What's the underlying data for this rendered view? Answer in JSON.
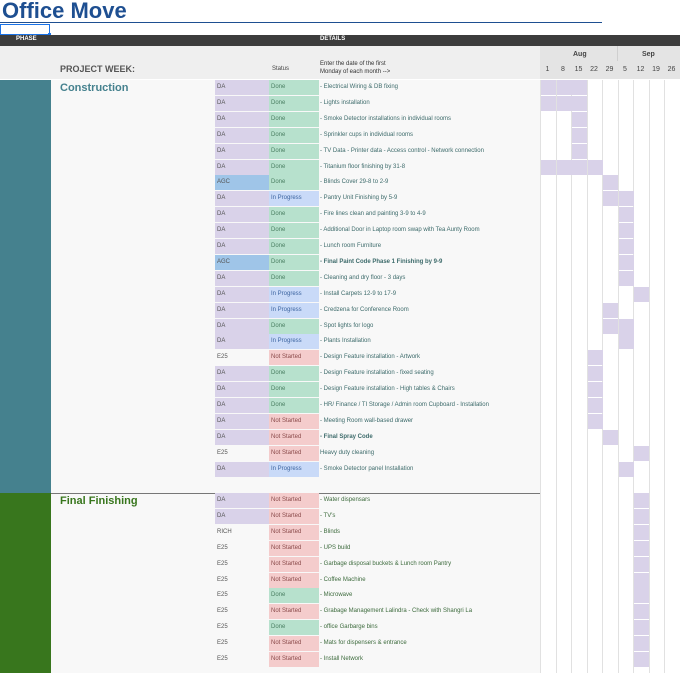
{
  "title": "Office Move",
  "header": {
    "phase": "PHASE",
    "details": "DETAILS"
  },
  "subheader": {
    "project_week": "PROJECT WEEK:",
    "status": "Status",
    "enter_date_line1": "Enter the date of the first",
    "enter_date_line2": "Monday of each month -->"
  },
  "gantt": {
    "months": [
      "Aug",
      "Sep"
    ],
    "weeks": [
      "1",
      "8",
      "15",
      "22",
      "29",
      "5",
      "12",
      "19",
      "26"
    ]
  },
  "colors": {
    "construction": "#45818e",
    "final_finishing": "#38761d",
    "done": "#b7e1cd",
    "in_progress": "#c9daf8",
    "not_started": "#f4cccc",
    "owner_da": "#d9d2e9",
    "owner_agc": "#9fc5e8",
    "gantt_fill": "#d9d2e9"
  },
  "sections": [
    {
      "name": "Construction",
      "rows": [
        {
          "owner": "DA",
          "status": "Done",
          "task": "- Electrical Wiring & DB fixing",
          "bold": false,
          "weeks": [
            0,
            1,
            2
          ]
        },
        {
          "owner": "DA",
          "status": "Done",
          "task": "- Lights installation",
          "bold": false,
          "weeks": [
            0,
            1,
            2
          ]
        },
        {
          "owner": "DA",
          "status": "Done",
          "task": "- Smoke Detector installations in individual rooms",
          "bold": false,
          "weeks": [
            2
          ]
        },
        {
          "owner": "DA",
          "status": "Done",
          "task": "- Sprinkler cups in individual rooms",
          "bold": false,
          "weeks": [
            2
          ]
        },
        {
          "owner": "DA",
          "status": "Done",
          "task": "- TV Data - Printer data - Access control - Network connection",
          "bold": false,
          "weeks": [
            2
          ]
        },
        {
          "owner": "DA",
          "status": "Done",
          "task": "- Titanium floor finishing by 31-8",
          "bold": false,
          "weeks": [
            0,
            1,
            2,
            3
          ]
        },
        {
          "owner": "AGC",
          "status": "Done",
          "task": "- Blinds Cover 29-8 to 2-9",
          "bold": false,
          "weeks": [
            4
          ]
        },
        {
          "owner": "DA",
          "status": "In Progress",
          "task": "- Pantry Unit Finishing by 5-9",
          "bold": false,
          "weeks": [
            4,
            5
          ]
        },
        {
          "owner": "DA",
          "status": "Done",
          "task": "- Fire lines clean and painting 3-9 to 4-9",
          "bold": false,
          "weeks": [
            5
          ]
        },
        {
          "owner": "DA",
          "status": "Done",
          "task": "- Additional Door in Laptop room swap with Tea Aunty Room",
          "bold": false,
          "weeks": [
            5
          ]
        },
        {
          "owner": "DA",
          "status": "Done",
          "task": "- Lunch room Furniture",
          "bold": false,
          "weeks": [
            5
          ]
        },
        {
          "owner": "AGC",
          "status": "Done",
          "task": "- Final Paint Code Phase 1 Finishing by 9-9",
          "bold": true,
          "weeks": [
            5
          ]
        },
        {
          "owner": "DA",
          "status": "Done",
          "task": "- Cleaning and dry floor - 3 days",
          "bold": false,
          "weeks": [
            5
          ]
        },
        {
          "owner": "DA",
          "status": "In Progress",
          "task": "- Install Carpets 12-9 to 17-9",
          "bold": false,
          "weeks": [
            6
          ]
        },
        {
          "owner": "DA",
          "status": "In Progress",
          "task": "- Credzena for Conference Room",
          "bold": false,
          "weeks": [
            4
          ]
        },
        {
          "owner": "DA",
          "status": "Done",
          "task": "- Spot lights for logo",
          "bold": false,
          "weeks": [
            4,
            5
          ]
        },
        {
          "owner": "DA",
          "status": "In Progress",
          "task": "- Plants Installation",
          "bold": false,
          "weeks": [
            5
          ]
        },
        {
          "owner": "E25",
          "status": "Not Started",
          "task": "- Design Feature installation - Artwork",
          "bold": false,
          "weeks": [
            3
          ]
        },
        {
          "owner": "DA",
          "status": "Done",
          "task": "- Design Feature installation - fixed seating",
          "bold": false,
          "weeks": [
            3
          ]
        },
        {
          "owner": "DA",
          "status": "Done",
          "task": "- Design Feature installation - High tables & Chairs",
          "bold": false,
          "weeks": [
            3
          ]
        },
        {
          "owner": "DA",
          "status": "Done",
          "task": "- HR/ Finance / TI Storage / Admin room Cupboard - Installation",
          "bold": false,
          "weeks": [
            3
          ]
        },
        {
          "owner": "DA",
          "status": "Not Started",
          "task": "- Meeting Room wall-based drawer",
          "bold": false,
          "weeks": [
            3
          ]
        },
        {
          "owner": "DA",
          "status": "Not Started",
          "task": "- Final Spray Code",
          "bold": true,
          "weeks": [
            4
          ]
        },
        {
          "owner": "E25",
          "status": "Not Started",
          "task": "Heavy duty cleaning",
          "bold": false,
          "weeks": [
            6
          ]
        },
        {
          "owner": "DA",
          "status": "In Progress",
          "task": "- Smoke Detector panel Installation",
          "bold": false,
          "weeks": [
            5
          ]
        }
      ]
    },
    {
      "name": "Final Finishing",
      "rows": [
        {
          "owner": "DA",
          "status": "Not Started",
          "task": "- Water dispensars",
          "bold": false,
          "weeks": [
            6
          ]
        },
        {
          "owner": "DA",
          "status": "Not Started",
          "task": "- TV's",
          "bold": false,
          "weeks": [
            6
          ]
        },
        {
          "owner": "RICH",
          "status": "Not Started",
          "task": "- Blinds",
          "bold": false,
          "weeks": [
            6
          ]
        },
        {
          "owner": "E25",
          "status": "Not Started",
          "task": "- UPS build",
          "bold": false,
          "weeks": [
            6
          ]
        },
        {
          "owner": "E25",
          "status": "Not Started",
          "task": "- Garbage disposal buckets & Lunch room Pantry",
          "bold": false,
          "weeks": [
            6
          ]
        },
        {
          "owner": "E25",
          "status": "Not Started",
          "task": "- Coffee Machine",
          "bold": false,
          "weeks": [
            6
          ]
        },
        {
          "owner": "E25",
          "status": "Done",
          "task": "- Microwave",
          "bold": false,
          "weeks": [
            6
          ]
        },
        {
          "owner": "E25",
          "status": "Not Started",
          "task": "- Grabage Management Lalindra - Check with Shangri La",
          "bold": false,
          "weeks": [
            6
          ]
        },
        {
          "owner": "E25",
          "status": "Done",
          "task": "- office Garbarge bins",
          "bold": false,
          "weeks": [
            6
          ]
        },
        {
          "owner": "E25",
          "status": "Not Started",
          "task": "- Mats for dispensers & entrance",
          "bold": false,
          "weeks": [
            6
          ]
        },
        {
          "owner": "E25",
          "status": "Not Started",
          "task": "- Install Network",
          "bold": false,
          "weeks": [
            6
          ]
        }
      ]
    }
  ]
}
